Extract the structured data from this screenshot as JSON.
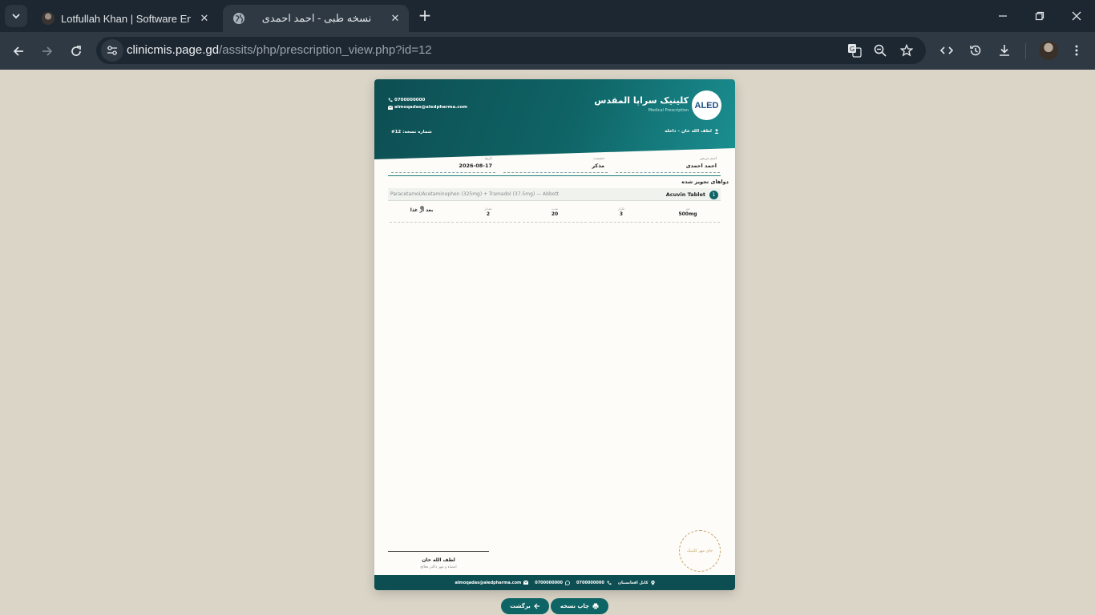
{
  "browser": {
    "tabs": [
      {
        "title": "Lotfullah Khan | Software Engine",
        "active": false
      },
      {
        "title": "نسخه طبی - احمد احمدی",
        "active": true
      }
    ],
    "url_host": "clinicmis.page.gd",
    "url_path": "/assits/php/prescription_view.php?id=12"
  },
  "prescription": {
    "clinic_name": "کلینیک سراپا المقدس",
    "clinic_subtitle": "Medical Prescription",
    "logo_text": "ALED",
    "phone": "0700000000",
    "email": "almoqadas@aledpharma.com",
    "doctor": "لطف الله خان – داخله",
    "rx_number": "شماره نسخه: 12#",
    "patient": {
      "name_label": "اسم مریض",
      "name": "احمد احمدی",
      "gender_label": "جنسیت",
      "gender": "مذکر",
      "date_label": "تاریخ",
      "date": "2026-08-17"
    },
    "section_title": "دواهای تجویز شده",
    "medications": [
      {
        "number": "1",
        "name": "Acuvin Tablet",
        "generic": "Paracetamol/Acetaminophen (325mg) + Tramadol (37.5mg) — Abbott",
        "details": [
          {
            "label": "دوز",
            "value": "500mg"
          },
          {
            "label": "تکرار",
            "value": "3"
          },
          {
            "label": "مدت",
            "value": "20"
          },
          {
            "label": "مقدار",
            "value": "2"
          },
          {
            "label": "",
            "value": "بعد از غذا"
          }
        ]
      }
    ],
    "stamp_text": "جای مهر کلینیک",
    "signature_name": "لطف الله خان",
    "signature_sub": "امضاء و مهر داکتر معالج",
    "footer": {
      "location": "کابل افغانستان",
      "phone1": "0700000000",
      "phone2": "0700000000",
      "email": "almoqadas@aledpharma.com"
    }
  },
  "actions": {
    "print": "چاپ نسخه",
    "back": "برگشت"
  }
}
